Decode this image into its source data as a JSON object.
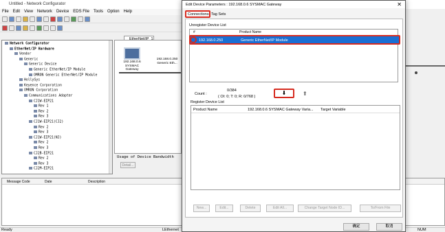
{
  "app": {
    "title": "Untitled - Network Configurator"
  },
  "menu": [
    "File",
    "Edit",
    "View",
    "Network",
    "Device",
    "EDS File",
    "Tools",
    "Option",
    "Help"
  ],
  "tree": {
    "items": [
      {
        "label": "Network Configurator",
        "depth": 0
      },
      {
        "label": "EtherNet/IP Hardware",
        "depth": 1
      },
      {
        "label": "Vendor",
        "depth": 2
      },
      {
        "label": "Generic",
        "depth": 3
      },
      {
        "label": "Generic Device",
        "depth": 4
      },
      {
        "label": "Generic EtherNet/IP Module",
        "depth": 5
      },
      {
        "label": "OMRON Generic EtherNet/IP Module",
        "depth": 5
      },
      {
        "label": "HollySys",
        "depth": 3
      },
      {
        "label": "Keyence Corporation",
        "depth": 3
      },
      {
        "label": "OMRON Corporation",
        "depth": 3
      },
      {
        "label": "Communications Adapter",
        "depth": 4
      },
      {
        "label": "CJ1W-EIP21",
        "depth": 5
      },
      {
        "label": "Rev 1",
        "depth": 6
      },
      {
        "label": "Rev 2",
        "depth": 6
      },
      {
        "label": "Rev 3",
        "depth": 6
      },
      {
        "label": "CJ1W-EIP21(CJ2)",
        "depth": 5
      },
      {
        "label": "Rev 2",
        "depth": 6
      },
      {
        "label": "Rev 3",
        "depth": 6
      },
      {
        "label": "CJ1W-EIP21(NJ)",
        "depth": 5
      },
      {
        "label": "Rev 2",
        "depth": 6
      },
      {
        "label": "Rev 3",
        "depth": 6
      },
      {
        "label": "CJ2B-EIP21",
        "depth": 5
      },
      {
        "label": "Rev 2",
        "depth": 6
      },
      {
        "label": "Rev 3",
        "depth": 6
      },
      {
        "label": "CJ2M-EIP21",
        "depth": 5
      }
    ]
  },
  "network": {
    "tab": "EtherNet/IP_1",
    "devices": [
      {
        "ip": "192.168.0.6",
        "name": "SYSMAC Gateway"
      },
      {
        "ip": "192.168.0.250",
        "name": "Generic Eth..."
      }
    ]
  },
  "bandwidth": {
    "label": "Usage of Device Bandwidth",
    "detail": "Detail..."
  },
  "log": {
    "columns": [
      "Message Code",
      "Date",
      "Description"
    ]
  },
  "status": {
    "ready": "Ready",
    "net": "LEthernet",
    "num": "NUM"
  },
  "dialog": {
    "title": "Edit Device Parameters : 192.168.0.6 SYSMAC Gateway",
    "tabs": [
      "Connections",
      "Tag Sets"
    ],
    "unregister": {
      "label": "Unregister Device List",
      "col_num": "#",
      "col_name": "Product Name",
      "row_ip": "192.168.0.250",
      "row_name": "Generic EtherNet/IP Module"
    },
    "count": {
      "label": "Count :",
      "value": "0/384",
      "sub": "( OI: 0; T: 0; R: 0/768 )"
    },
    "register": {
      "label": "Register Device List",
      "col_product": "Product Name",
      "col_dev": "192.168.0.6 SYSMAC Gateway Varia...",
      "col_target": "Target Variable"
    },
    "buttons": [
      "New...",
      "Edit...",
      "Delete",
      "Edit All...",
      "Change Target Node ID...",
      "To/From File"
    ],
    "ok": "确定",
    "cancel": "取消"
  }
}
